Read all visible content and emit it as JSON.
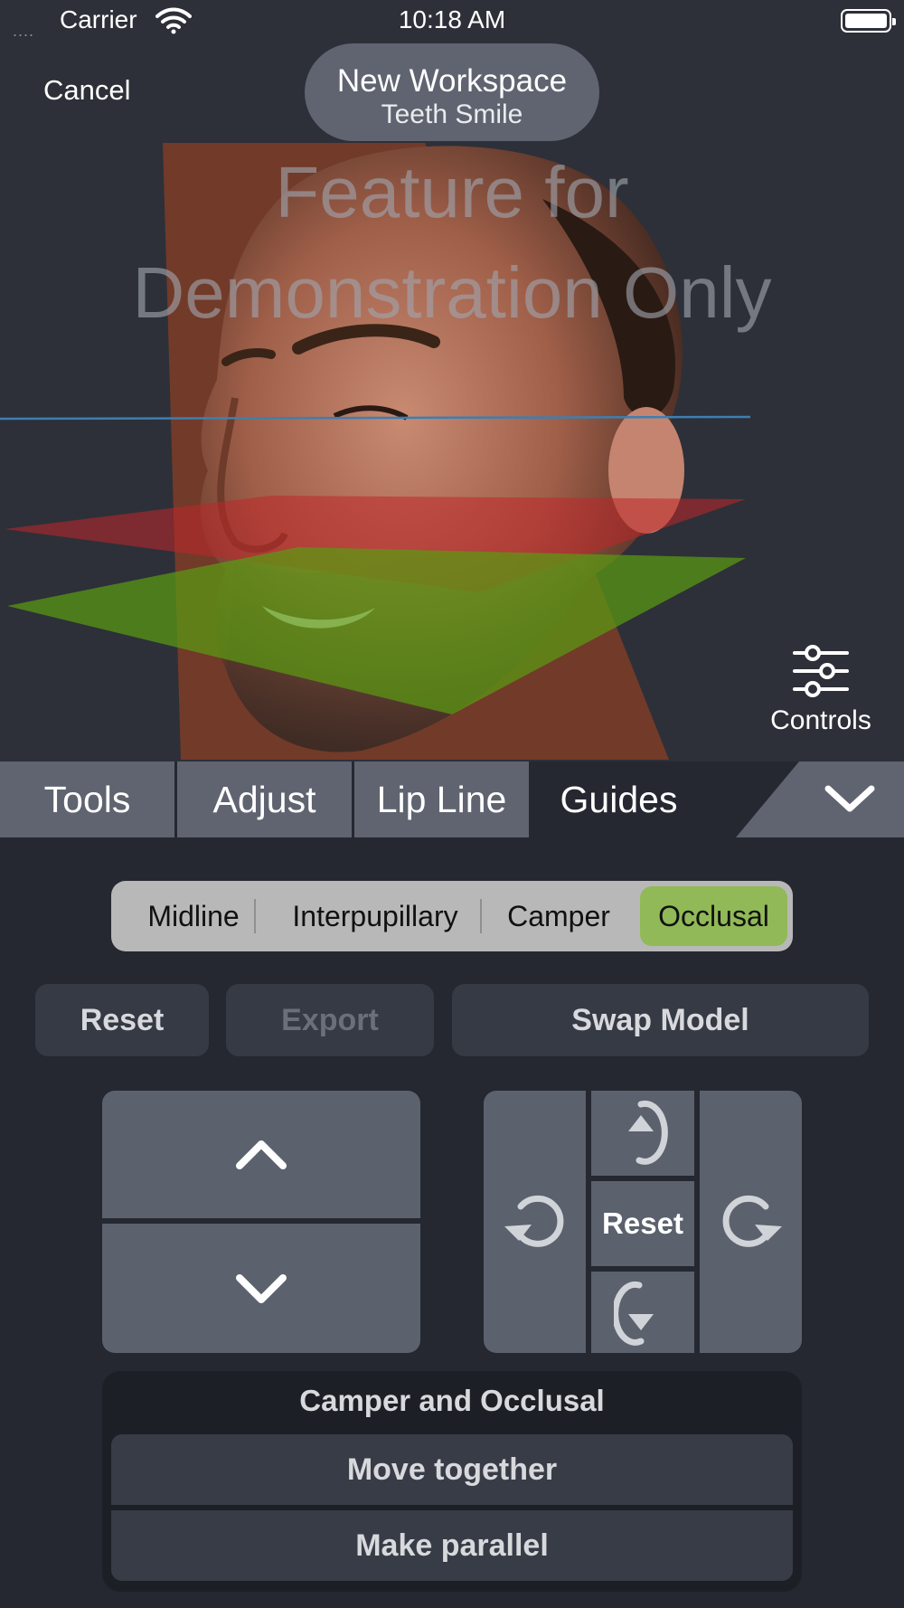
{
  "status_bar": {
    "signal": "....",
    "carrier": "Carrier",
    "time": "10:18 AM"
  },
  "header": {
    "cancel_label": "Cancel",
    "workspace_title": "New Workspace",
    "workspace_subtitle": "Teeth Smile"
  },
  "viewport": {
    "watermark_line1": "Feature for",
    "watermark_line2": "Demonstration Only",
    "controls_label": "Controls",
    "guide_plane_colors": {
      "interpupillary": "#3d7fb2",
      "camper": "#c0262a",
      "occlusal": "#5a9a12",
      "midline": "#c84818"
    }
  },
  "tabs": [
    {
      "label": "Tools",
      "active": false
    },
    {
      "label": "Adjust",
      "active": false
    },
    {
      "label": "Lip Line",
      "active": false
    },
    {
      "label": "Guides",
      "active": true
    }
  ],
  "guides": {
    "segments": [
      "Midline",
      "Interpupillary",
      "Camper",
      "Occlusal"
    ],
    "selected": "Occlusal",
    "accent_color": "#91b957"
  },
  "actions": {
    "reset_label": "Reset",
    "export_label": "Export",
    "swap_label": "Swap Model"
  },
  "rotate": {
    "reset_label": "Reset"
  },
  "pair": {
    "title": "Camper and Occlusal",
    "move_together_label": "Move together",
    "make_parallel_label": "Make parallel"
  }
}
